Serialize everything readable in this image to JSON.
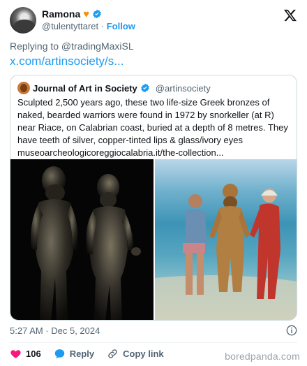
{
  "author": {
    "name": "Ramona",
    "handle": "@tulentyttaret",
    "separator": "·",
    "follow_label": "Follow"
  },
  "replying_to": "Replying to @tradingMaxiSL",
  "link_text": "x.com/artinsociety/s...",
  "quoted": {
    "name": "Journal of Art in Society",
    "handle": "@artinsociety",
    "text": "Sculpted 2,500 years ago, these two life-size Greek bronzes of naked, bearded warriors were found in 1972 by snorkeller (at R) near Riace, on Calabrian coast, buried at a depth of 8 metres. They have teeth of silver, copper-tinted lips & glass/ivory eyes museoarcheologicoreggiocalabria.it/the-collection..."
  },
  "timestamp": "5:27 AM · Dec 5, 2024",
  "actions": {
    "like_count": "106",
    "reply_label": "Reply",
    "copy_link_label": "Copy link"
  },
  "watermark": "boredpanda.com",
  "colors": {
    "accent": "#1d9bf0",
    "like": "#f91880",
    "heart_emoji": "#f4900c",
    "muted": "#536471"
  }
}
